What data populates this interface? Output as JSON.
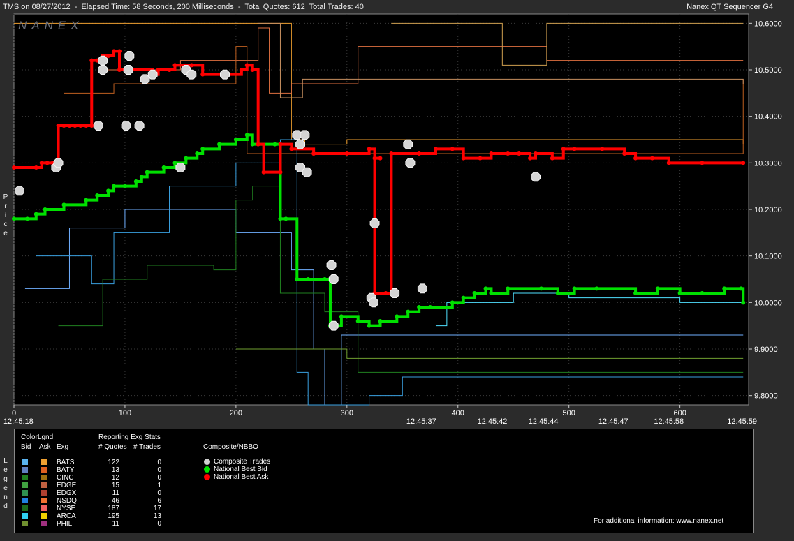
{
  "header": {
    "left": "TMS on 08/27/2012  -  Elapsed Time: 58 Seconds, 200 Milliseconds  -  Total Quotes: 612  Total Trades: 40",
    "right": "Nanex QT Sequencer G4",
    "watermark": "NANEX"
  },
  "side_labels": {
    "price": [
      "P",
      "r",
      "i",
      "c",
      "e"
    ],
    "legend": [
      "L",
      "e",
      "g",
      "e",
      "n",
      "d"
    ]
  },
  "chart_data": {
    "type": "line",
    "ylim": [
      9.78,
      10.62
    ],
    "xlim": [
      0,
      660
    ],
    "y_ticks": [
      {
        "v": 10.6,
        "label": "10.6000"
      },
      {
        "v": 10.5,
        "label": "10.5000"
      },
      {
        "v": 10.4,
        "label": "10.4000"
      },
      {
        "v": 10.3,
        "label": "10.3000"
      },
      {
        "v": 10.2,
        "label": "10.2000"
      },
      {
        "v": 10.1,
        "label": "10.1000"
      },
      {
        "v": 10.0,
        "label": "10.0000"
      },
      {
        "v": 9.9,
        "label": "9.9000"
      },
      {
        "v": 9.8,
        "label": "9.8000"
      }
    ],
    "x_ticks": [
      {
        "v": 0,
        "label": "0"
      },
      {
        "v": 100,
        "label": "100"
      },
      {
        "v": 200,
        "label": "200"
      },
      {
        "v": 300,
        "label": "300"
      },
      {
        "v": 400,
        "label": "400"
      },
      {
        "v": 500,
        "label": "500"
      },
      {
        "v": 600,
        "label": "600"
      }
    ],
    "time_labels": [
      {
        "v": 4,
        "label": "12:45:18"
      },
      {
        "v": 367,
        "label": "12:45:37"
      },
      {
        "v": 431,
        "label": "12:45:42"
      },
      {
        "v": 477,
        "label": "12:45:44"
      },
      {
        "v": 540,
        "label": "12:45:47"
      },
      {
        "v": 590,
        "label": "12:45:58"
      },
      {
        "v": 656,
        "label": "12:45:59"
      }
    ],
    "nbbo_bid": [
      [
        0,
        10.18
      ],
      [
        12,
        10.18
      ],
      [
        20,
        10.19
      ],
      [
        28,
        10.2
      ],
      [
        45,
        10.21
      ],
      [
        65,
        10.22
      ],
      [
        75,
        10.23
      ],
      [
        85,
        10.24
      ],
      [
        90,
        10.25
      ],
      [
        100,
        10.25
      ],
      [
        110,
        10.26
      ],
      [
        115,
        10.27
      ],
      [
        120,
        10.28
      ],
      [
        135,
        10.29
      ],
      [
        145,
        10.3
      ],
      [
        155,
        10.31
      ],
      [
        165,
        10.32
      ],
      [
        170,
        10.33
      ],
      [
        185,
        10.34
      ],
      [
        200,
        10.35
      ],
      [
        210,
        10.36
      ],
      [
        215,
        10.34
      ],
      [
        235,
        10.34
      ],
      [
        240,
        10.18
      ],
      [
        245,
        10.18
      ],
      [
        255,
        10.05
      ],
      [
        265,
        10.05
      ],
      [
        280,
        10.05
      ],
      [
        285,
        9.95
      ],
      [
        295,
        9.97
      ],
      [
        310,
        9.96
      ],
      [
        320,
        9.95
      ],
      [
        330,
        9.96
      ],
      [
        345,
        9.97
      ],
      [
        355,
        9.98
      ],
      [
        365,
        9.99
      ],
      [
        375,
        9.99
      ],
      [
        395,
        10.0
      ],
      [
        405,
        10.01
      ],
      [
        415,
        10.02
      ],
      [
        425,
        10.03
      ],
      [
        430,
        10.02
      ],
      [
        445,
        10.03
      ],
      [
        475,
        10.03
      ],
      [
        490,
        10.02
      ],
      [
        505,
        10.03
      ],
      [
        525,
        10.03
      ],
      [
        560,
        10.02
      ],
      [
        580,
        10.03
      ],
      [
        600,
        10.02
      ],
      [
        620,
        10.02
      ],
      [
        640,
        10.03
      ],
      [
        655,
        10.03
      ],
      [
        657,
        10.0
      ]
    ],
    "nbbo_ask": [
      [
        0,
        10.29
      ],
      [
        20,
        10.29
      ],
      [
        25,
        10.3
      ],
      [
        30,
        10.3
      ],
      [
        35,
        10.3
      ],
      [
        40,
        10.3
      ],
      [
        40,
        10.38
      ],
      [
        45,
        10.38
      ],
      [
        50,
        10.38
      ],
      [
        55,
        10.38
      ],
      [
        60,
        10.38
      ],
      [
        65,
        10.38
      ],
      [
        70,
        10.38
      ],
      [
        70,
        10.52
      ],
      [
        75,
        10.52
      ],
      [
        80,
        10.53
      ],
      [
        85,
        10.53
      ],
      [
        90,
        10.54
      ],
      [
        95,
        10.54
      ],
      [
        95,
        10.5
      ],
      [
        125,
        10.49
      ],
      [
        130,
        10.5
      ],
      [
        140,
        10.5
      ],
      [
        145,
        10.51
      ],
      [
        160,
        10.51
      ],
      [
        170,
        10.49
      ],
      [
        190,
        10.49
      ],
      [
        205,
        10.5
      ],
      [
        210,
        10.51
      ],
      [
        215,
        10.5
      ],
      [
        220,
        10.34
      ],
      [
        225,
        10.28
      ],
      [
        240,
        10.28
      ],
      [
        240,
        10.34
      ],
      [
        250,
        10.33
      ],
      [
        270,
        10.32
      ],
      [
        300,
        10.32
      ],
      [
        320,
        10.33
      ],
      [
        325,
        10.31
      ],
      [
        330,
        10.31
      ],
      [
        325,
        10.02
      ],
      [
        335,
        10.02
      ],
      [
        340,
        10.32
      ],
      [
        365,
        10.32
      ],
      [
        380,
        10.33
      ],
      [
        395,
        10.33
      ],
      [
        405,
        10.31
      ],
      [
        420,
        10.31
      ],
      [
        430,
        10.32
      ],
      [
        445,
        10.32
      ],
      [
        455,
        10.32
      ],
      [
        465,
        10.31
      ],
      [
        470,
        10.32
      ],
      [
        485,
        10.31
      ],
      [
        495,
        10.33
      ],
      [
        505,
        10.33
      ],
      [
        530,
        10.33
      ],
      [
        550,
        10.32
      ],
      [
        560,
        10.31
      ],
      [
        575,
        10.31
      ],
      [
        590,
        10.3
      ],
      [
        620,
        10.3
      ],
      [
        657,
        10.3
      ]
    ],
    "composite_trades": [
      [
        5,
        10.24
      ],
      [
        38,
        10.29
      ],
      [
        40,
        10.3
      ],
      [
        76,
        10.38
      ],
      [
        80,
        10.5
      ],
      [
        80,
        10.52
      ],
      [
        101,
        10.38
      ],
      [
        103,
        10.5
      ],
      [
        104,
        10.53
      ],
      [
        113,
        10.38
      ],
      [
        118,
        10.48
      ],
      [
        125,
        10.49
      ],
      [
        150,
        10.29
      ],
      [
        155,
        10.5
      ],
      [
        160,
        10.49
      ],
      [
        190,
        10.49
      ],
      [
        255,
        10.36
      ],
      [
        258,
        10.34
      ],
      [
        262,
        10.36
      ],
      [
        258,
        10.29
      ],
      [
        264,
        10.28
      ],
      [
        286,
        10.08
      ],
      [
        288,
        10.05
      ],
      [
        288,
        9.95
      ],
      [
        322,
        10.01
      ],
      [
        324,
        10.0
      ],
      [
        325,
        10.17
      ],
      [
        343,
        10.02
      ],
      [
        355,
        10.34
      ],
      [
        357,
        10.3
      ],
      [
        368,
        10.03
      ],
      [
        470,
        10.27
      ]
    ],
    "exchange_traces": [
      {
        "name": "BATS",
        "color": "#f0a030",
        "pts": [
          [
            0,
            10.6
          ],
          [
            240,
            10.6
          ],
          [
            250,
            10.35
          ],
          [
            262,
            10.34
          ],
          [
            290,
            10.34
          ],
          [
            300,
            10.35
          ],
          [
            430,
            10.35
          ],
          [
            657,
            10.34
          ]
        ]
      },
      {
        "name": "BATY",
        "color": "#e07040",
        "pts": [
          [
            80,
            10.5
          ],
          [
            150,
            10.52
          ],
          [
            220,
            10.59
          ],
          [
            230,
            10.45
          ],
          [
            250,
            10.47
          ],
          [
            310,
            10.55
          ],
          [
            480,
            10.52
          ],
          [
            657,
            10.52
          ]
        ]
      },
      {
        "name": "CINC",
        "color": "#c06020",
        "pts": [
          [
            45,
            10.45
          ],
          [
            90,
            10.47
          ],
          [
            200,
            10.55
          ],
          [
            210,
            10.32
          ],
          [
            657,
            10.48
          ]
        ]
      },
      {
        "name": "EDGE",
        "color": "#c89060",
        "pts": [
          [
            220,
            10.6
          ],
          [
            240,
            10.44
          ],
          [
            260,
            10.48
          ],
          [
            657,
            10.47
          ]
        ]
      },
      {
        "name": "EDGX",
        "color": "#d0a050",
        "pts": [
          [
            340,
            10.6
          ],
          [
            440,
            10.6
          ],
          [
            440,
            10.51
          ],
          [
            480,
            10.51
          ],
          [
            480,
            10.6
          ],
          [
            657,
            10.6
          ]
        ]
      },
      {
        "name": "NSDQ",
        "color": "#70b0ff",
        "pts": [
          [
            10,
            10.03
          ],
          [
            40,
            10.03
          ],
          [
            50,
            10.16
          ],
          [
            70,
            10.16
          ],
          [
            100,
            10.2
          ],
          [
            150,
            10.2
          ],
          [
            200,
            10.15
          ],
          [
            250,
            10.07
          ],
          [
            270,
            9.9
          ],
          [
            280,
            9.78
          ],
          [
            290,
            9.78
          ],
          [
            295,
            9.93
          ],
          [
            657,
            9.93
          ]
        ]
      },
      {
        "name": "BATS-bid",
        "color": "#3aa0e0",
        "pts": [
          [
            20,
            10.1
          ],
          [
            40,
            10.1
          ],
          [
            70,
            10.04
          ],
          [
            90,
            10.15
          ],
          [
            140,
            10.25
          ],
          [
            200,
            10.3
          ],
          [
            240,
            10.35
          ],
          [
            255,
            9.85
          ],
          [
            265,
            9.78
          ],
          [
            300,
            9.78
          ],
          [
            320,
            9.8
          ],
          [
            350,
            9.84
          ],
          [
            380,
            9.84
          ],
          [
            657,
            9.84
          ]
        ]
      },
      {
        "name": "ARCA",
        "color": "#50e0ff",
        "pts": [
          [
            380,
            9.95
          ],
          [
            390,
            10.0
          ],
          [
            420,
            10.0
          ],
          [
            450,
            10.02
          ],
          [
            500,
            10.01
          ],
          [
            560,
            10.01
          ],
          [
            600,
            10.0
          ],
          [
            657,
            10.0
          ]
        ]
      },
      {
        "name": "NYSE",
        "color": "#208020",
        "pts": [
          [
            40,
            9.95
          ],
          [
            80,
            10.05
          ],
          [
            120,
            10.08
          ],
          [
            180,
            10.07
          ],
          [
            200,
            10.22
          ],
          [
            215,
            10.25
          ],
          [
            240,
            10.02
          ],
          [
            280,
            9.98
          ],
          [
            310,
            9.85
          ],
          [
            380,
            9.85
          ],
          [
            657,
            9.85
          ]
        ]
      },
      {
        "name": "PHIL",
        "color": "#70a030",
        "pts": [
          [
            200,
            9.9
          ],
          [
            300,
            9.88
          ],
          [
            400,
            9.88
          ],
          [
            657,
            9.88
          ]
        ]
      }
    ]
  },
  "legend": {
    "header1": "ColorLgnd",
    "header2": "Reporting Exg Stats",
    "col_bid": "Bid",
    "col_ask": "Ask",
    "col_exg": "Exg",
    "col_quotes": "# Quotes",
    "col_trades": "# Trades",
    "composite_title": "Composite/NBBO",
    "rows": [
      {
        "exg": "BATS",
        "quotes": "122",
        "trades": "0",
        "bid": "#5ab4f0",
        "ask": "#f0a030"
      },
      {
        "exg": "BATY",
        "quotes": "13",
        "trades": "0",
        "bid": "#6080c0",
        "ask": "#e06020"
      },
      {
        "exg": "CINC",
        "quotes": "12",
        "trades": "0",
        "bid": "#208020",
        "ask": "#a07010"
      },
      {
        "exg": "EDGE",
        "quotes": "15",
        "trades": "1",
        "bid": "#40a040",
        "ask": "#c06040"
      },
      {
        "exg": "EDGX",
        "quotes": "11",
        "trades": "0",
        "bid": "#309050",
        "ask": "#b04030"
      },
      {
        "exg": "NSDQ",
        "quotes": "46",
        "trades": "6",
        "bid": "#2080e0",
        "ask": "#f07030"
      },
      {
        "exg": "NYSE",
        "quotes": "187",
        "trades": "17",
        "bid": "#1c6a1c",
        "ask": "#f06060"
      },
      {
        "exg": "ARCA",
        "quotes": "195",
        "trades": "13",
        "bid": "#30d0f0",
        "ask": "#f0d000"
      },
      {
        "exg": "PHIL",
        "quotes": "11",
        "trades": "0",
        "bid": "#709030",
        "ask": "#a03080"
      }
    ],
    "composite": [
      {
        "label": "Composite Trades",
        "color": "#d0d0d0"
      },
      {
        "label": "National Best Bid",
        "color": "#00e000"
      },
      {
        "label": "National Best Ask",
        "color": "#ff0000"
      }
    ],
    "footer": "For additional information: www.nanex.net"
  }
}
